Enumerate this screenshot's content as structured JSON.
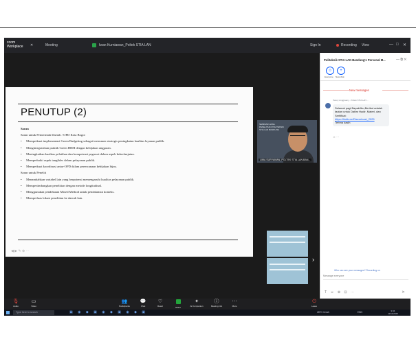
{
  "window": {
    "app_name_top": "zoom",
    "app_name": "Workplace",
    "tabs": [
      "Meeting"
    ],
    "share_title": "Iwan Kurniawan_Poltek STIA LAN",
    "recording_label": "Recording",
    "view_label": "View",
    "sign_in": "Sign In"
  },
  "slide": {
    "title": "PENUTUP (2)",
    "section1_heading": "Saran",
    "section1_subheading": "Saran untuk Pemerintah Daerah / OPD Kota Bogor",
    "section1_items": [
      "Memperkuat implementasi Green Budgeting sebagai instrumen strategis peningkatan kualitas layanan publik.",
      "Mengintegrasikan praktik Green HRM dengan kebijakan anggaran.",
      "Meningkatkan kualitas pelatihan dan kompetensi pegawai dalam aspek keberlanjutan.",
      "Memperbaiki aspek tangibles dalam pelayanan publik.",
      "Memperkuat koordinasi antar-OPD dalam perencanaan kebijakan hijau."
    ],
    "section2_heading": "Saran untuk Peneliti",
    "section2_items": [
      "Menambahkan variabel lain yang berpotensi memengaruhi kualitas pelayanan publik.",
      "Mempertimbangkan penelitian dengan metode longitudinal.",
      "Menggunakan pendekatan Mixed Method untuk pendalaman konteks.",
      "Memperluas lokasi penelitian ke daerah lain."
    ]
  },
  "video": {
    "main_name": "LIMA SURYAWAN_POLTEK STIA LAN BAN...",
    "main_banner": "SEMINAR HASIL PENELITIAN POLITEKNIK STIA LAN BANDUNG"
  },
  "chat": {
    "title": "Politeknik STIA LAN Bandung's Personal M...",
    "btn_everyone": "Everyone",
    "btn_new": "New chat",
    "new_messages_label": "New messages",
    "message": {
      "sender": "Panny Anggraeny - Poltek STIA LAN ...",
      "text": "Selamat pagi Bapak/Ibu,Berikut adalah tautan untuk Daftar Hadir, Materi, dan Sertifikat:",
      "link": "https://linktr.ee/Diseminasi_2025",
      "sign_off": "Terima kasih"
    },
    "notice": "Who can see your messages? Recording on",
    "input_placeholder": "Message everyone"
  },
  "toolbar": {
    "items": [
      {
        "label": "Audio",
        "icon": "microphone-icon"
      },
      {
        "label": "Video",
        "icon": "camera-icon"
      },
      {
        "label": "Participants",
        "icon": "participants-icon"
      },
      {
        "label": "Chat",
        "icon": "chat-icon"
      },
      {
        "label": "React",
        "icon": "heart-icon"
      },
      {
        "label": "Share",
        "icon": "share-icon"
      },
      {
        "label": "AI Companion",
        "icon": "sparkle-icon"
      },
      {
        "label": "Meeting info",
        "icon": "info-icon"
      },
      {
        "label": "More",
        "icon": "more-icon"
      },
      {
        "label": "Leave",
        "icon": "leave-icon"
      }
    ]
  },
  "taskbar": {
    "search_placeholder": "Type here to search",
    "weather": "28°C Cerah",
    "language": "ENG",
    "time": "9:04",
    "date": "12/11/2025"
  },
  "colors": {
    "zoom_blue": "#0b5cff",
    "share_green": "#23a53b",
    "leave_red": "#e0463c",
    "new_msg_red": "#d93025"
  }
}
